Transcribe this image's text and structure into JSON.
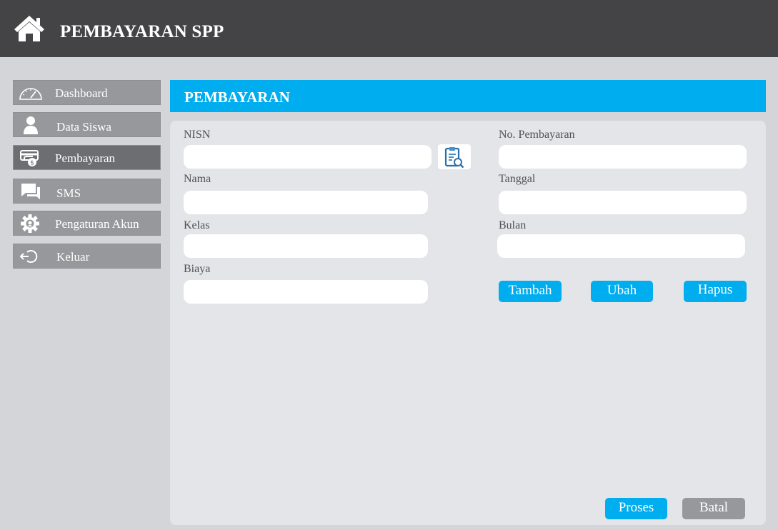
{
  "header": {
    "title": "PEMBAYARAN SPP",
    "icon": "home-icon"
  },
  "sidebar": {
    "items": [
      {
        "label": "Dashboard",
        "icon": "gauge-icon",
        "active": false
      },
      {
        "label": "Data Siswa",
        "icon": "user-icon",
        "active": false
      },
      {
        "label": "Pembayaran",
        "icon": "payment-icon",
        "active": true
      },
      {
        "label": "SMS",
        "icon": "chat-icon",
        "active": false
      },
      {
        "label": "Pengaturan Akun",
        "icon": "gear-icon",
        "active": false
      },
      {
        "label": "Keluar",
        "icon": "logout-icon",
        "active": false
      }
    ]
  },
  "panel": {
    "title": "PEMBAYARAN"
  },
  "form": {
    "nisn": {
      "label": "NISN",
      "value": ""
    },
    "nama": {
      "label": "Nama",
      "value": ""
    },
    "kelas": {
      "label": "Kelas",
      "value": ""
    },
    "biaya": {
      "label": "Biaya",
      "value": ""
    },
    "no_pembayaran": {
      "label": "No. Pembayaran",
      "value": ""
    },
    "tanggal": {
      "label": "Tanggal",
      "value": ""
    },
    "bulan": {
      "label": "Bulan",
      "value": ""
    }
  },
  "actions": {
    "tambah": "Tambah",
    "ubah": "Ubah",
    "hapus": "Hapus",
    "proses": "Proses",
    "batal": "Batal"
  },
  "colors": {
    "accent": "#00adef",
    "topbar": "#444446",
    "sidebar_item": "#97989b",
    "sidebar_active": "#6d6e71"
  }
}
